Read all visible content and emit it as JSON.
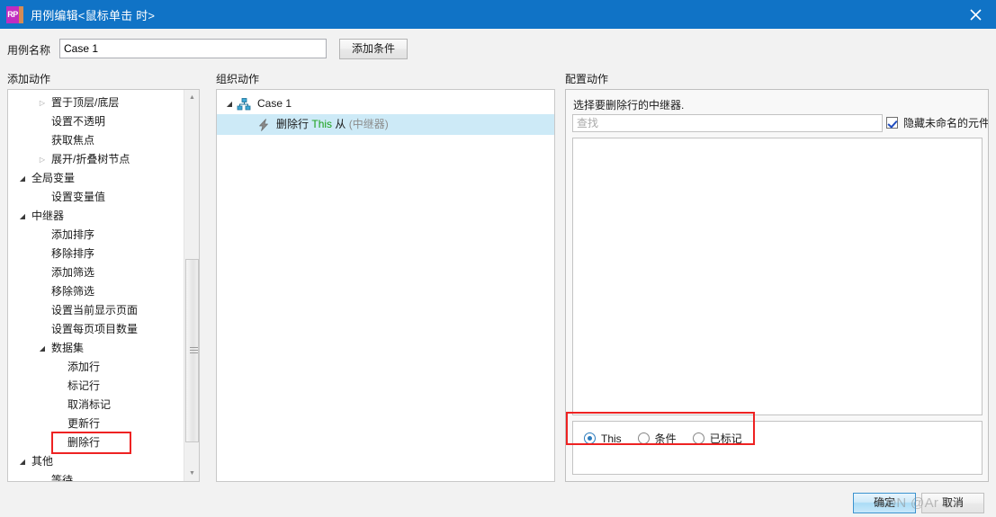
{
  "window": {
    "title": "用例编辑<鼠标单击 时>",
    "app_icon_text": "RP",
    "close_icon": "close-icon",
    "titlebar_color": "#1073c6"
  },
  "case_row": {
    "label": "用例名称",
    "input_value": "Case 1",
    "input_placeholder": "",
    "add_condition_button": "添加条件"
  },
  "columns": {
    "add_action": "添加动作",
    "organize_action": "组织动作",
    "configure_action": "配置动作"
  },
  "action_tree": {
    "items": [
      {
        "label": "置于顶层/底层",
        "level": 1,
        "arrow": "collapsed",
        "highlight": false
      },
      {
        "label": "设置不透明",
        "level": 2,
        "arrow": "none",
        "highlight": false
      },
      {
        "label": "获取焦点",
        "level": 2,
        "arrow": "none",
        "highlight": false
      },
      {
        "label": "展开/折叠树节点",
        "level": 1,
        "arrow": "collapsed",
        "highlight": false
      },
      {
        "label": "全局变量",
        "level": 0,
        "arrow": "expanded",
        "highlight": false
      },
      {
        "label": "设置变量值",
        "level": 2,
        "arrow": "none",
        "highlight": false
      },
      {
        "label": "中继器",
        "level": 0,
        "arrow": "expanded",
        "highlight": false
      },
      {
        "label": "添加排序",
        "level": 2,
        "arrow": "none",
        "highlight": false
      },
      {
        "label": "移除排序",
        "level": 2,
        "arrow": "none",
        "highlight": false
      },
      {
        "label": "添加筛选",
        "level": 2,
        "arrow": "none",
        "highlight": false
      },
      {
        "label": "移除筛选",
        "level": 2,
        "arrow": "none",
        "highlight": false
      },
      {
        "label": "设置当前显示页面",
        "level": 2,
        "arrow": "none",
        "highlight": false
      },
      {
        "label": "设置每页项目数量",
        "level": 2,
        "arrow": "none",
        "highlight": false
      },
      {
        "label": "数据集",
        "level": 1,
        "arrow": "expanded",
        "highlight": false
      },
      {
        "label": "添加行",
        "level": 3,
        "arrow": "none",
        "highlight": false
      },
      {
        "label": "标记行",
        "level": 3,
        "arrow": "none",
        "highlight": false
      },
      {
        "label": "取消标记",
        "level": 3,
        "arrow": "none",
        "highlight": false
      },
      {
        "label": "更新行",
        "level": 3,
        "arrow": "none",
        "highlight": false
      },
      {
        "label": "删除行",
        "level": 3,
        "arrow": "none",
        "highlight": true
      },
      {
        "label": "其他",
        "level": 0,
        "arrow": "expanded",
        "highlight": false
      },
      {
        "label": "等待",
        "level": 2,
        "arrow": "none",
        "highlight": false
      }
    ],
    "scrollbar": {
      "up_icon": "scroll-up-icon",
      "down_icon": "scroll-down-icon"
    },
    "highlight_color": "#ee2222"
  },
  "organize_tree": {
    "rows": [
      {
        "kind": "case",
        "icon": "sitemap-icon",
        "arrow": "expanded",
        "label": "Case 1",
        "selected": false
      },
      {
        "kind": "action",
        "icon": "lightning-icon",
        "label_main": "删除行",
        "label_target": "This",
        "label_mid": "从",
        "label_source": "(中继器)",
        "selected": true
      }
    ],
    "selected_row_color": "#cdeaf7",
    "target_color": "#1aa11a",
    "source_color": "#8c8c8c"
  },
  "configure": {
    "prompt": "选择要删除行的中继器.",
    "search_value": "",
    "search_placeholder": "查找",
    "hide_unnamed_checkbox": {
      "label": "隐藏未命名的元件",
      "checked": true
    },
    "list_items": [],
    "radios": [
      {
        "label": "This",
        "selected": true
      },
      {
        "label": "条件",
        "selected": false
      },
      {
        "label": "已标记",
        "selected": false
      }
    ],
    "radio_highlight_color": "#ee2222"
  },
  "footer": {
    "ok_button": "确定",
    "cancel_button": "取消"
  },
  "watermark": {
    "text": "SDN @Ar    lin"
  }
}
